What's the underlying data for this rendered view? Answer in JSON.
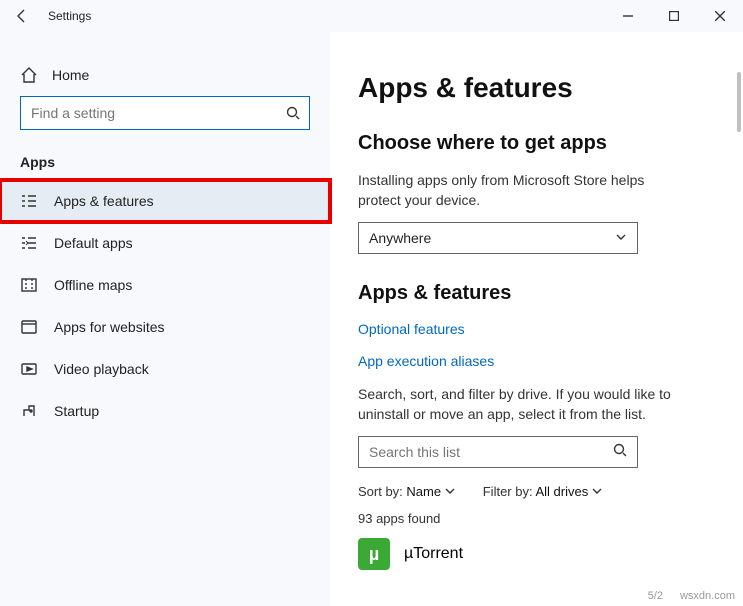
{
  "titlebar": {
    "title": "Settings"
  },
  "sidebar": {
    "home": "Home",
    "searchPlaceholder": "Find a setting",
    "category": "Apps",
    "items": [
      {
        "label": "Apps & features"
      },
      {
        "label": "Default apps"
      },
      {
        "label": "Offline maps"
      },
      {
        "label": "Apps for websites"
      },
      {
        "label": "Video playback"
      },
      {
        "label": "Startup"
      }
    ]
  },
  "content": {
    "pageTitle": "Apps & features",
    "section1": {
      "heading": "Choose where to get apps",
      "desc": "Installing apps only from Microsoft Store helps protect your device.",
      "dropdownValue": "Anywhere"
    },
    "section2": {
      "heading": "Apps & features",
      "link1": "Optional features",
      "link2": "App execution aliases",
      "desc": "Search, sort, and filter by drive. If you would like to uninstall or move an app, select it from the list.",
      "searchPlaceholder": "Search this list",
      "sortLabel": "Sort by:",
      "sortValue": "Name",
      "filterLabel": "Filter by:",
      "filterValue": "All drives",
      "count": "93 apps found",
      "app0": {
        "name": "µTorrent"
      }
    }
  },
  "watermark": "wsxdn.com",
  "dateFragment": "5/2"
}
